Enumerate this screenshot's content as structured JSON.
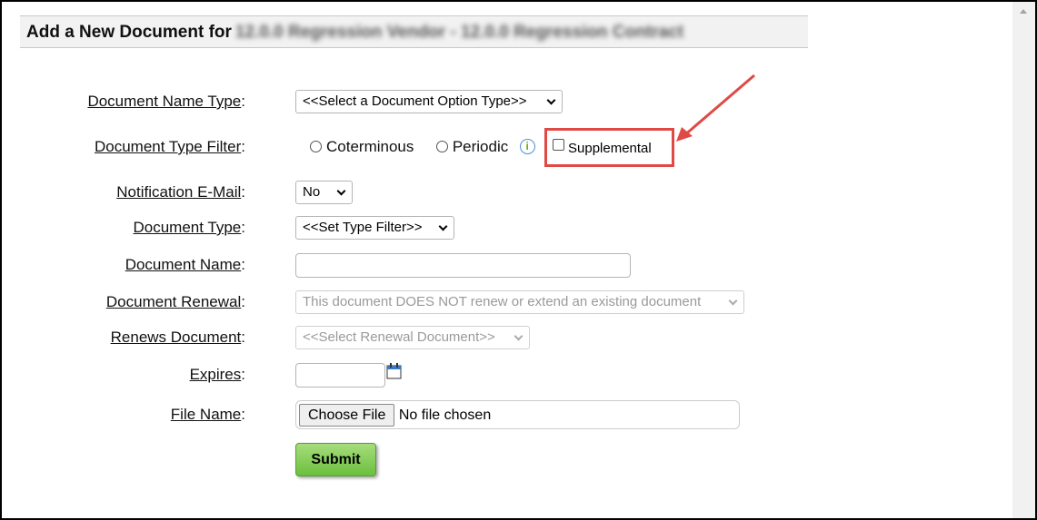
{
  "header": {
    "title": "Add a New Document for",
    "context": "12.0.0 Regression Vendor - 12.0.0 Regression Contract"
  },
  "form": {
    "doc_name_type": {
      "label": "Document Name Type",
      "value": "<<Select a Document Option Type>>"
    },
    "type_filter": {
      "label": "Document Type Filter",
      "options": [
        "Coterminous",
        "Periodic"
      ],
      "supplemental": "Supplemental",
      "info_icon": "i"
    },
    "notification": {
      "label": "Notification E-Mail",
      "value": "No"
    },
    "doc_type": {
      "label": "Document Type",
      "value": "<<Set Type Filter>>"
    },
    "doc_name": {
      "label": "Document Name",
      "value": ""
    },
    "renewal": {
      "label": "Document Renewal",
      "value": "This document DOES NOT renew or extend an existing document"
    },
    "renews": {
      "label": "Renews Document",
      "value": "<<Select Renewal Document>>"
    },
    "expires": {
      "label": "Expires",
      "value": ""
    },
    "file": {
      "label": "File Name",
      "button": "Choose File",
      "status": "No file chosen"
    },
    "submit": "Submit"
  },
  "colors": {
    "highlight": "#e04a45",
    "submit": "#7ac943"
  }
}
